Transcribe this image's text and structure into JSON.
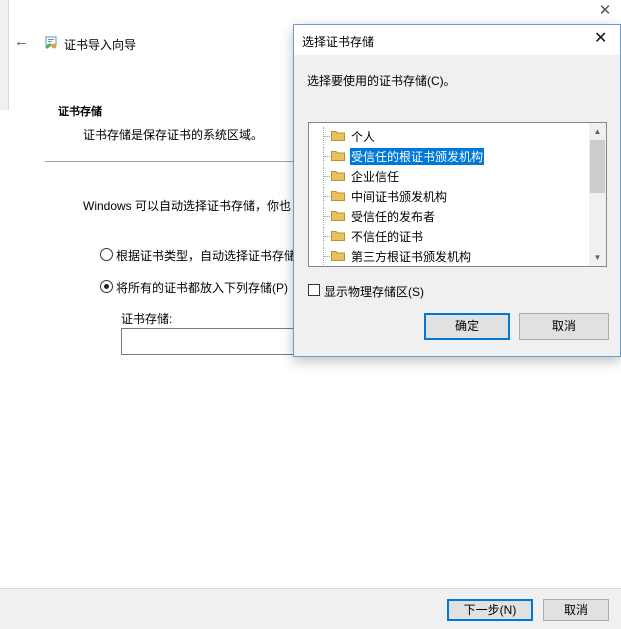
{
  "wizard": {
    "title": "证书导入向导",
    "section_title": "证书存储",
    "section_desc": "证书存储是保存证书的系统区域。",
    "intro": "Windows 可以自动选择证书存储，你也",
    "radio_auto": "根据证书类型，自动选择证书存储",
    "radio_manual": "将所有的证书都放入下列存储(P)",
    "store_label": "证书存储:",
    "store_value": "",
    "next_label": "下一步(N)",
    "cancel_label": "取消",
    "close_glyph": "✕",
    "back_glyph": "←"
  },
  "dialog": {
    "title": "选择证书存储",
    "close_glyph": "✕",
    "prompt": "选择要使用的证书存储(C)。",
    "items": [
      {
        "label": "个人",
        "selected": false
      },
      {
        "label": "受信任的根证书颁发机构",
        "selected": true
      },
      {
        "label": "企业信任",
        "selected": false
      },
      {
        "label": "中间证书颁发机构",
        "selected": false
      },
      {
        "label": "受信任的发布者",
        "selected": false
      },
      {
        "label": "不信任的证书",
        "selected": false
      },
      {
        "label": "第三方根证书颁发机构",
        "selected": false
      }
    ],
    "show_physical_label": "显示物理存储区(S)",
    "show_physical_checked": false,
    "ok_label": "确定",
    "cancel_label": "取消"
  },
  "colors": {
    "accent": "#0078d7",
    "folder": "#e8c35a"
  },
  "icons": [
    "back-arrow-icon",
    "certificate-icon",
    "folder-icon",
    "close-icon",
    "scroll-up-icon",
    "scroll-down-icon"
  ]
}
